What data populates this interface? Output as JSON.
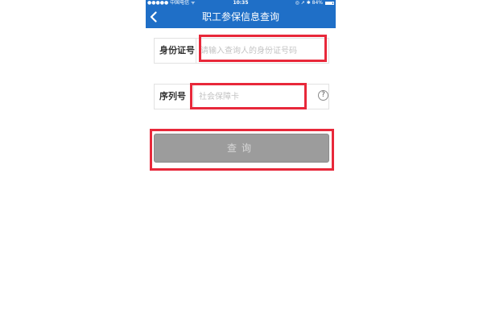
{
  "status_bar": {
    "carrier": "●●●●● 中国电信 ᯤ",
    "time": "10:35",
    "right_indicators": "◎ ➚ ✱ 84%",
    "battery_level": 0.84
  },
  "nav": {
    "title": "职工参保信息查询"
  },
  "form": {
    "id_label": "身份证号",
    "id_placeholder": "请输入查询人的身份证号码",
    "id_value": "",
    "serial_label": "序列号",
    "serial_placeholder": "社会保障卡",
    "serial_value": "",
    "help_glyph": "?"
  },
  "query_button": {
    "label": "查询"
  },
  "icons": {
    "back": "chevron-left-icon",
    "help": "question-circle-icon",
    "battery": "battery-icon"
  },
  "colors": {
    "nav_blue": "#1f6fc7",
    "highlight_red": "#e8283a",
    "button_gray": "#9c9c9c"
  }
}
